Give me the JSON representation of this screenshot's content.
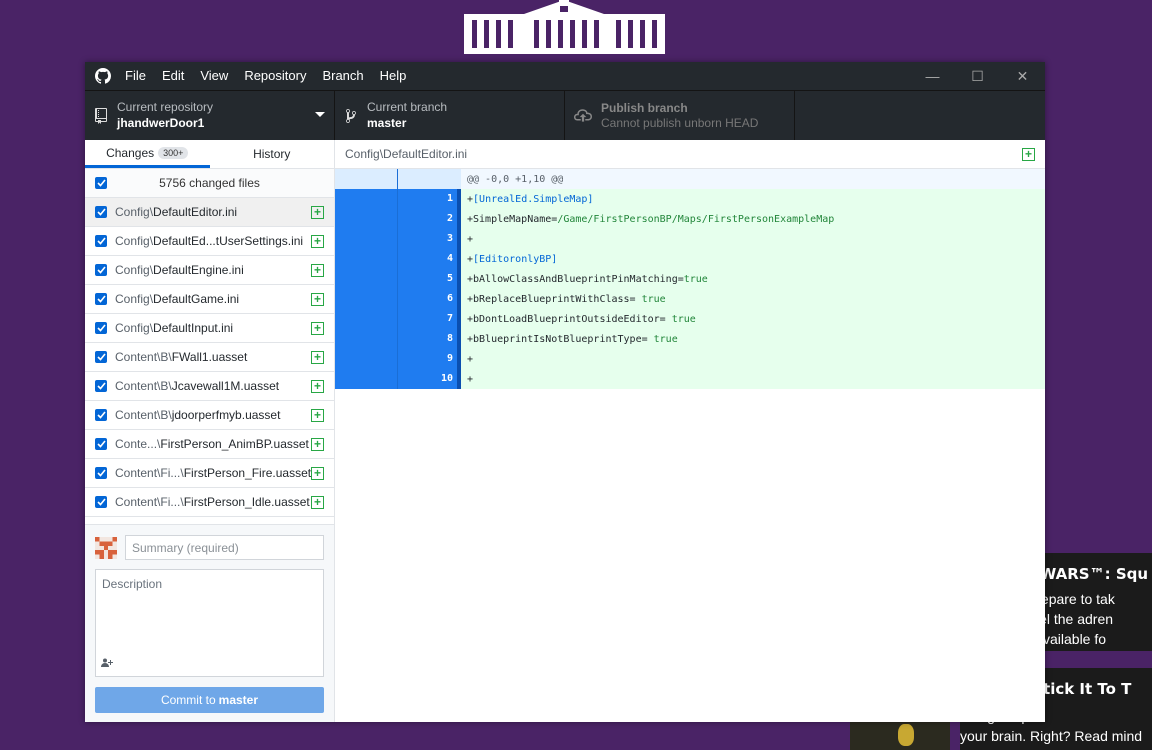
{
  "app": {
    "menu": [
      "File",
      "Edit",
      "View",
      "Repository",
      "Branch",
      "Help"
    ],
    "window_controls": {
      "minimize": "—",
      "maximize": "☐",
      "close": "✕"
    }
  },
  "toolbar": {
    "repo": {
      "label": "Current repository",
      "value": "jhandwerDoor1"
    },
    "branch": {
      "label": "Current branch",
      "value": "master"
    },
    "publish": {
      "label": "Publish branch",
      "value": "Cannot publish unborn HEAD"
    }
  },
  "sidebar": {
    "tabs": [
      {
        "label": "Changes",
        "count": "300+"
      },
      {
        "label": "History"
      }
    ],
    "changed_files_label": "5756 changed files",
    "files": [
      {
        "dir": "Config\\",
        "name": "DefaultEditor.ini"
      },
      {
        "dir": "Config\\",
        "name": "DefaultEd...tUserSettings.ini"
      },
      {
        "dir": "Config\\",
        "name": "DefaultEngine.ini"
      },
      {
        "dir": "Config\\",
        "name": "DefaultGame.ini"
      },
      {
        "dir": "Config\\",
        "name": "DefaultInput.ini"
      },
      {
        "dir": "Content\\B\\",
        "name": "FWall1.uasset"
      },
      {
        "dir": "Content\\B\\",
        "name": "Jcavewall1M.uasset"
      },
      {
        "dir": "Content\\B\\",
        "name": "jdoorperfmyb.uasset"
      },
      {
        "dir": "Conte...\\",
        "name": "FirstPerson_AnimBP.uasset"
      },
      {
        "dir": "Content\\Fi...\\",
        "name": "FirstPerson_Fire.uasset"
      },
      {
        "dir": "Content\\Fi...\\",
        "name": "FirstPerson_Idle.uasset"
      }
    ],
    "commit": {
      "summary_placeholder": "Summary (required)",
      "description_placeholder": "Description",
      "button_prefix": "Commit to",
      "button_branch": "master"
    }
  },
  "diff": {
    "path": "Config\\DefaultEditor.ini",
    "hunk_header": "@@ -0,0 +1,10 @@",
    "lines": [
      {
        "num": "1",
        "text": "+[UnrealEd.SimpleMap]"
      },
      {
        "num": "2",
        "text": "+SimpleMapName=/Game/FirstPersonBP/Maps/FirstPersonExampleMap"
      },
      {
        "num": "3",
        "text": "+"
      },
      {
        "num": "4",
        "text": "+[EditoronlyBP]"
      },
      {
        "num": "5",
        "text": "+bAllowClassAndBlueprintPinMatching=true"
      },
      {
        "num": "6",
        "text": "+bReplaceBlueprintWithClass= true"
      },
      {
        "num": "7",
        "text": "+bDontLoadBlueprintOutsideEditor= true"
      },
      {
        "num": "8",
        "text": "+bBlueprintIsNotBlueprintType= true"
      },
      {
        "num": "9",
        "text": "+"
      },
      {
        "num": "10",
        "text": "+"
      }
    ]
  },
  "background": {
    "news1": {
      "title": "R WARS™: Squ",
      "lines": [
        "nd prepare to tak",
        "y. Feel the adren",
        "itle. Available fo"
      ]
    },
    "news2": {
      "title": ": Stick It To T",
      "lines": [
        "p with a giant pi",
        "your brain. Right? Read mind"
      ]
    }
  },
  "colors": {
    "accent": "#0366d6",
    "titlebar": "#24292e",
    "desktop": "#4a2366",
    "added_bg": "#e6ffed"
  }
}
